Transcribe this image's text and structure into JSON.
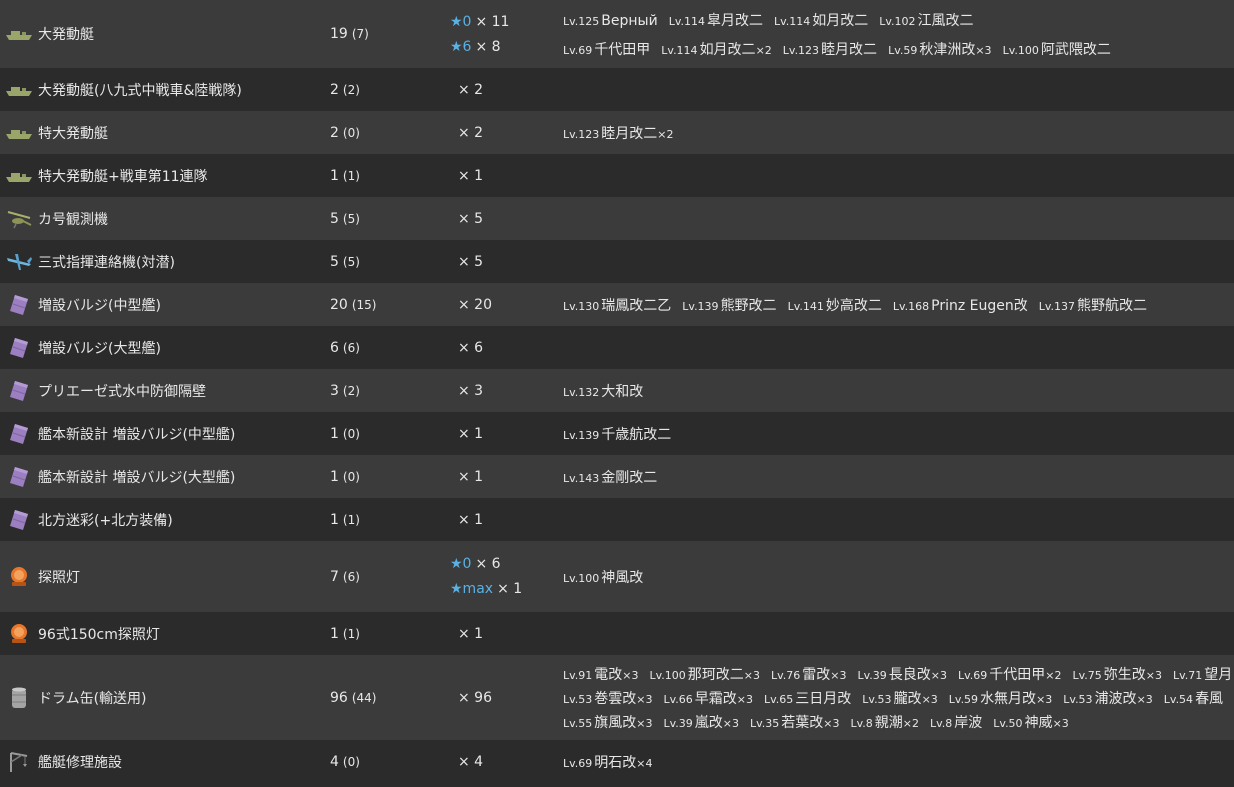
{
  "colors": {
    "star": "#5bb1e4",
    "row_odd": "#3b3b3b",
    "row_even": "#2b2b2b"
  },
  "rows": [
    {
      "icon": "landing-craft-icon",
      "name": "大発動艇",
      "count": "19",
      "count_sub": "(7)",
      "improvements": [
        {
          "star": "★0",
          "mult": "× 11"
        },
        {
          "star": "★6",
          "mult": "× 8"
        }
      ],
      "ships": [
        [
          {
            "lv": "Lv.125",
            "name": "Верный"
          },
          {
            "lv": "Lv.114",
            "name": "皐月改二"
          },
          {
            "lv": "Lv.114",
            "name": "如月改二"
          },
          {
            "lv": "Lv.102",
            "name": "江風改二"
          }
        ],
        [
          {
            "lv": "Lv.69",
            "name": "千代田甲"
          },
          {
            "lv": "Lv.114",
            "name": "如月改二",
            "cnt": "×2"
          },
          {
            "lv": "Lv.123",
            "name": "睦月改二"
          },
          {
            "lv": "Lv.59",
            "name": "秋津洲改",
            "cnt": "×3"
          },
          {
            "lv": "Lv.100",
            "name": "阿武隈改二"
          }
        ]
      ]
    },
    {
      "icon": "landing-craft-icon",
      "name": "大発動艇(八九式中戦車&陸戦隊)",
      "count": "2",
      "count_sub": "(2)",
      "improvements": [
        {
          "star": "",
          "mult": "× 2"
        }
      ],
      "ships": []
    },
    {
      "icon": "landing-craft-icon",
      "name": "特大発動艇",
      "count": "2",
      "count_sub": "(0)",
      "improvements": [
        {
          "star": "",
          "mult": "× 2"
        }
      ],
      "ships": [
        [
          {
            "lv": "Lv.123",
            "name": "睦月改二",
            "cnt": "×2"
          }
        ]
      ]
    },
    {
      "icon": "landing-craft-icon",
      "name": "特大発動艇+戦車第11連隊",
      "count": "1",
      "count_sub": "(1)",
      "improvements": [
        {
          "star": "",
          "mult": "× 1"
        }
      ],
      "ships": []
    },
    {
      "icon": "autogyro-icon",
      "name": "カ号観測機",
      "count": "5",
      "count_sub": "(5)",
      "improvements": [
        {
          "star": "",
          "mult": "× 5"
        }
      ],
      "ships": []
    },
    {
      "icon": "liaison-plane-icon",
      "name": "三式指揮連絡機(対潜)",
      "count": "5",
      "count_sub": "(5)",
      "improvements": [
        {
          "star": "",
          "mult": "× 5"
        }
      ],
      "ships": []
    },
    {
      "icon": "bulge-icon",
      "name": "増設バルジ(中型艦)",
      "count": "20",
      "count_sub": "(15)",
      "improvements": [
        {
          "star": "",
          "mult": "× 20"
        }
      ],
      "ships": [
        [
          {
            "lv": "Lv.130",
            "name": "瑞鳳改二乙"
          },
          {
            "lv": "Lv.139",
            "name": "熊野改二"
          },
          {
            "lv": "Lv.141",
            "name": "妙高改二"
          },
          {
            "lv": "Lv.168",
            "name": "Prinz Eugen改"
          },
          {
            "lv": "Lv.137",
            "name": "熊野航改二"
          }
        ]
      ]
    },
    {
      "icon": "bulge-icon",
      "name": "増設バルジ(大型艦)",
      "count": "6",
      "count_sub": "(6)",
      "improvements": [
        {
          "star": "",
          "mult": "× 6"
        }
      ],
      "ships": []
    },
    {
      "icon": "bulge-icon",
      "name": "プリエーゼ式水中防御隔壁",
      "count": "3",
      "count_sub": "(2)",
      "improvements": [
        {
          "star": "",
          "mult": "× 3"
        }
      ],
      "ships": [
        [
          {
            "lv": "Lv.132",
            "name": "大和改"
          }
        ]
      ]
    },
    {
      "icon": "bulge-icon",
      "name": "艦本新設計 増設バルジ(中型艦)",
      "count": "1",
      "count_sub": "(0)",
      "improvements": [
        {
          "star": "",
          "mult": "× 1"
        }
      ],
      "ships": [
        [
          {
            "lv": "Lv.139",
            "name": "千歳航改二"
          }
        ]
      ]
    },
    {
      "icon": "bulge-icon",
      "name": "艦本新設計 増設バルジ(大型艦)",
      "count": "1",
      "count_sub": "(0)",
      "improvements": [
        {
          "star": "",
          "mult": "× 1"
        }
      ],
      "ships": [
        [
          {
            "lv": "Lv.143",
            "name": "金剛改二"
          }
        ]
      ]
    },
    {
      "icon": "bulge-icon",
      "name": "北方迷彩(+北方装備)",
      "count": "1",
      "count_sub": "(1)",
      "improvements": [
        {
          "star": "",
          "mult": "× 1"
        }
      ],
      "ships": []
    },
    {
      "icon": "searchlight-icon",
      "name": "探照灯",
      "count": "7",
      "count_sub": "(6)",
      "improvements": [
        {
          "star": "★0",
          "mult": "× 6"
        },
        {
          "star": "★max",
          "mult": "× 1"
        }
      ],
      "ships": [
        [
          {
            "lv": "Lv.100",
            "name": "神風改"
          }
        ]
      ]
    },
    {
      "icon": "searchlight-icon",
      "name": "96式150cm探照灯",
      "count": "1",
      "count_sub": "(1)",
      "improvements": [
        {
          "star": "",
          "mult": "× 1"
        }
      ],
      "ships": []
    },
    {
      "icon": "drum-icon",
      "name": "ドラム缶(輸送用)",
      "count": "96",
      "count_sub": "(44)",
      "improvements": [
        {
          "star": "",
          "mult": "× 96"
        }
      ],
      "ships": [
        [
          {
            "lv": "Lv.91",
            "name": "電改",
            "cnt": "×3"
          },
          {
            "lv": "Lv.100",
            "name": "那珂改二",
            "cnt": "×3"
          },
          {
            "lv": "Lv.76",
            "name": "雷改",
            "cnt": "×3"
          },
          {
            "lv": "Lv.39",
            "name": "長良改",
            "cnt": "×3"
          },
          {
            "lv": "Lv.69",
            "name": "千代田甲",
            "cnt": "×2"
          },
          {
            "lv": "Lv.75",
            "name": "弥生改",
            "cnt": "×3"
          },
          {
            "lv": "Lv.71",
            "name": "望月"
          }
        ],
        [
          {
            "lv": "Lv.53",
            "name": "巻雲改",
            "cnt": "×3"
          },
          {
            "lv": "Lv.66",
            "name": "早霜改",
            "cnt": "×3"
          },
          {
            "lv": "Lv.65",
            "name": "三日月改"
          },
          {
            "lv": "Lv.53",
            "name": "朧改",
            "cnt": "×3"
          },
          {
            "lv": "Lv.59",
            "name": "水無月改",
            "cnt": "×3"
          },
          {
            "lv": "Lv.53",
            "name": "浦波改",
            "cnt": "×3"
          },
          {
            "lv": "Lv.54",
            "name": "春風"
          }
        ],
        [
          {
            "lv": "Lv.55",
            "name": "旗風改",
            "cnt": "×3"
          },
          {
            "lv": "Lv.39",
            "name": "嵐改",
            "cnt": "×3"
          },
          {
            "lv": "Lv.35",
            "name": "若葉改",
            "cnt": "×3"
          },
          {
            "lv": "Lv.8",
            "name": "親潮",
            "cnt": "×2"
          },
          {
            "lv": "Lv.8",
            "name": "岸波"
          },
          {
            "lv": "Lv.50",
            "name": "神威",
            "cnt": "×3"
          }
        ]
      ]
    },
    {
      "icon": "repair-crane-icon",
      "name": "艦艇修理施設",
      "count": "4",
      "count_sub": "(0)",
      "improvements": [
        {
          "star": "",
          "mult": "× 4"
        }
      ],
      "ships": [
        [
          {
            "lv": "Lv.69",
            "name": "明石改",
            "cnt": "×4"
          }
        ]
      ]
    }
  ]
}
